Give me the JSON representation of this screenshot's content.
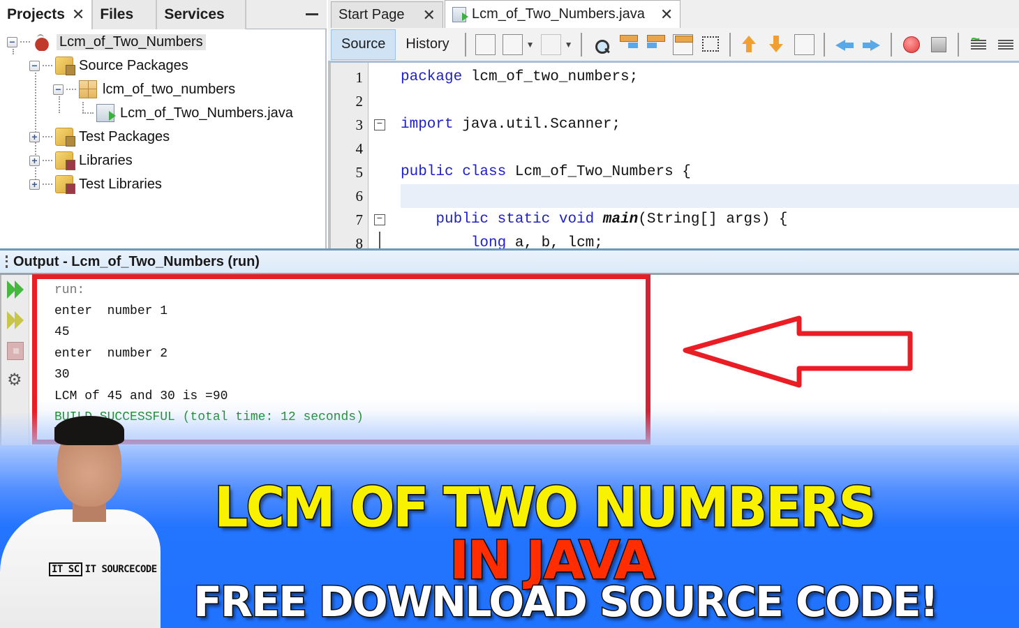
{
  "projects_panel": {
    "tabs": [
      {
        "label": "Projects",
        "active": true,
        "closable": true
      },
      {
        "label": "Files",
        "active": false
      },
      {
        "label": "Services",
        "active": false
      }
    ],
    "minimize_icon": "minimize-icon",
    "tree": [
      {
        "label": "Lcm_of_Two_Numbers",
        "icon": "java-project-icon",
        "expanded": true,
        "selected": true
      },
      {
        "label": "Source Packages",
        "icon": "source-folder-icon",
        "expanded": true
      },
      {
        "label": "lcm_of_two_numbers",
        "icon": "package-icon",
        "expanded": true
      },
      {
        "label": "Lcm_of_Two_Numbers.java",
        "icon": "java-file-icon"
      },
      {
        "label": "Test Packages",
        "icon": "source-folder-icon",
        "expanded": false
      },
      {
        "label": "Libraries",
        "icon": "library-folder-icon",
        "expanded": false
      },
      {
        "label": "Test Libraries",
        "icon": "library-folder-icon",
        "expanded": false
      }
    ]
  },
  "editor": {
    "tabs": [
      {
        "label": "Start Page",
        "active": false
      },
      {
        "label": "Lcm_of_Two_Numbers.java",
        "active": true
      }
    ],
    "view_tabs": [
      {
        "label": "Source",
        "active": true
      },
      {
        "label": "History",
        "active": false
      }
    ],
    "toolbar_icons": [
      "last-edit-icon",
      "back-icon",
      "forward-icon",
      "find-icon",
      "find-previous-icon",
      "find-next-icon",
      "toggle-highlight-icon",
      "toggle-rect-selection-icon",
      "previous-bookmark-icon",
      "next-bookmark-icon",
      "toggle-bookmark-icon",
      "shift-left-icon",
      "shift-right-icon",
      "start-macro-icon",
      "stop-macro-icon",
      "comment-icon",
      "uncomment-icon"
    ],
    "code_lines": [
      {
        "num": "1",
        "text": "package lcm_of_two_numbers;"
      },
      {
        "num": "2",
        "text": ""
      },
      {
        "num": "3",
        "text": "import java.util.Scanner;"
      },
      {
        "num": "4",
        "text": ""
      },
      {
        "num": "5",
        "text": "public class Lcm_of_Two_Numbers {"
      },
      {
        "num": "6",
        "text": ""
      },
      {
        "num": "7",
        "text": "    public static void main(String[] args) {"
      },
      {
        "num": "8",
        "text": "        long a, b, lcm;"
      }
    ]
  },
  "output": {
    "title": "Output - Lcm_of_Two_Numbers (run)",
    "side_icons": [
      "rerun-icon",
      "rerun-with-options-icon",
      "stop-icon",
      "settings-icon"
    ],
    "lines": [
      {
        "text": "run:",
        "kind": "run"
      },
      {
        "text": "enter  number 1",
        "kind": "normal"
      },
      {
        "text": "45",
        "kind": "normal"
      },
      {
        "text": "enter  number 2",
        "kind": "normal"
      },
      {
        "text": "30",
        "kind": "normal"
      },
      {
        "text": "LCM of 45 and 30 is =90",
        "kind": "normal"
      },
      {
        "text": "BUILD SUCCESSFUL (total time: 12 seconds)",
        "kind": "success"
      }
    ]
  },
  "annotations": {
    "highlight_box_color": "#ea1c24",
    "arrow_color": "#ea1c24",
    "arrow_direction": "left"
  },
  "banner": {
    "line1": "LCM OF TWO NUMBERS",
    "line2": "IN JAVA",
    "line3": "FREE DOWNLOAD SOURCE CODE!",
    "colors": {
      "line1": "#f8f200",
      "line2": "#ff2d00",
      "line3": "#ffffff",
      "background": "#2374ff"
    },
    "presenter_shirt_logo": "IT SOURCECODE",
    "presenter_shirt_mark": "IT SC"
  }
}
